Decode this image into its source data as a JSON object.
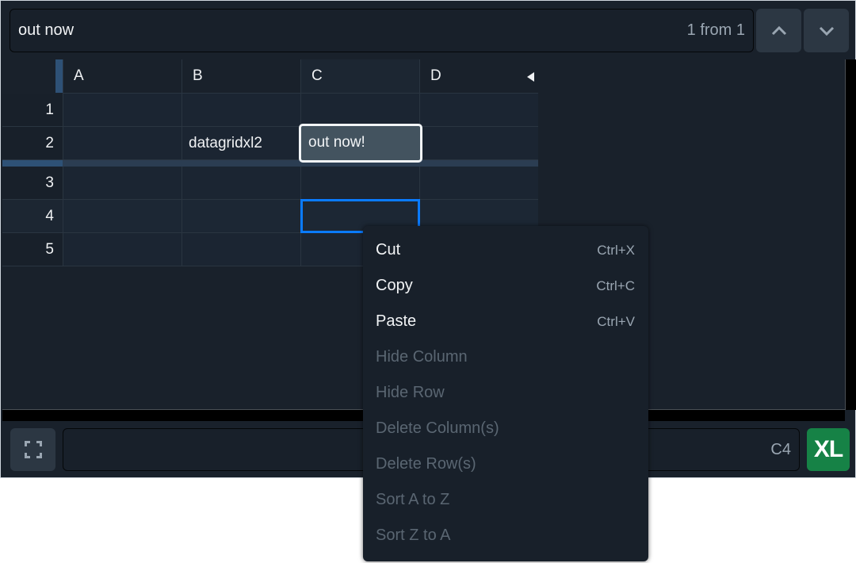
{
  "search": {
    "value": "out now",
    "result_count": "1 from 1",
    "prev_icon": "chevron-up-icon",
    "next_icon": "chevron-down-icon"
  },
  "grid": {
    "columns": [
      "A",
      "B",
      "C",
      "D"
    ],
    "rows": [
      "1",
      "2",
      "3",
      "4",
      "5"
    ],
    "cells": [
      [
        "",
        "",
        "",
        ""
      ],
      [
        "",
        "datagridxl2",
        "out now!",
        ""
      ],
      [
        "",
        "",
        "",
        ""
      ],
      [
        "",
        "",
        "",
        ""
      ],
      [
        "",
        "",
        "",
        ""
      ]
    ],
    "editing_cell_value": "out now!",
    "selected_cell": "C4"
  },
  "footer": {
    "fullscreen_icon": "fullscreen-icon",
    "formula_value": "",
    "cell_ref": "C4",
    "logo_label": "XL"
  },
  "context_menu": {
    "items": [
      {
        "label": "Cut",
        "shortcut": "Ctrl+X",
        "enabled": true
      },
      {
        "label": "Copy",
        "shortcut": "Ctrl+C",
        "enabled": true
      },
      {
        "label": "Paste",
        "shortcut": "Ctrl+V",
        "enabled": true
      },
      {
        "label": "Hide Column",
        "shortcut": "",
        "enabled": false
      },
      {
        "label": "Hide Row",
        "shortcut": "",
        "enabled": false
      },
      {
        "label": "Delete Column(s)",
        "shortcut": "",
        "enabled": false
      },
      {
        "label": "Delete Row(s)",
        "shortcut": "",
        "enabled": false
      },
      {
        "label": "Sort A to Z",
        "shortcut": "",
        "enabled": false
      },
      {
        "label": "Sort Z to A",
        "shortcut": "",
        "enabled": false
      }
    ]
  },
  "colors": {
    "background": "#19212b",
    "selection": "#0a7bff",
    "excel_green": "#168246",
    "frozen_marker": "#2e5176"
  }
}
